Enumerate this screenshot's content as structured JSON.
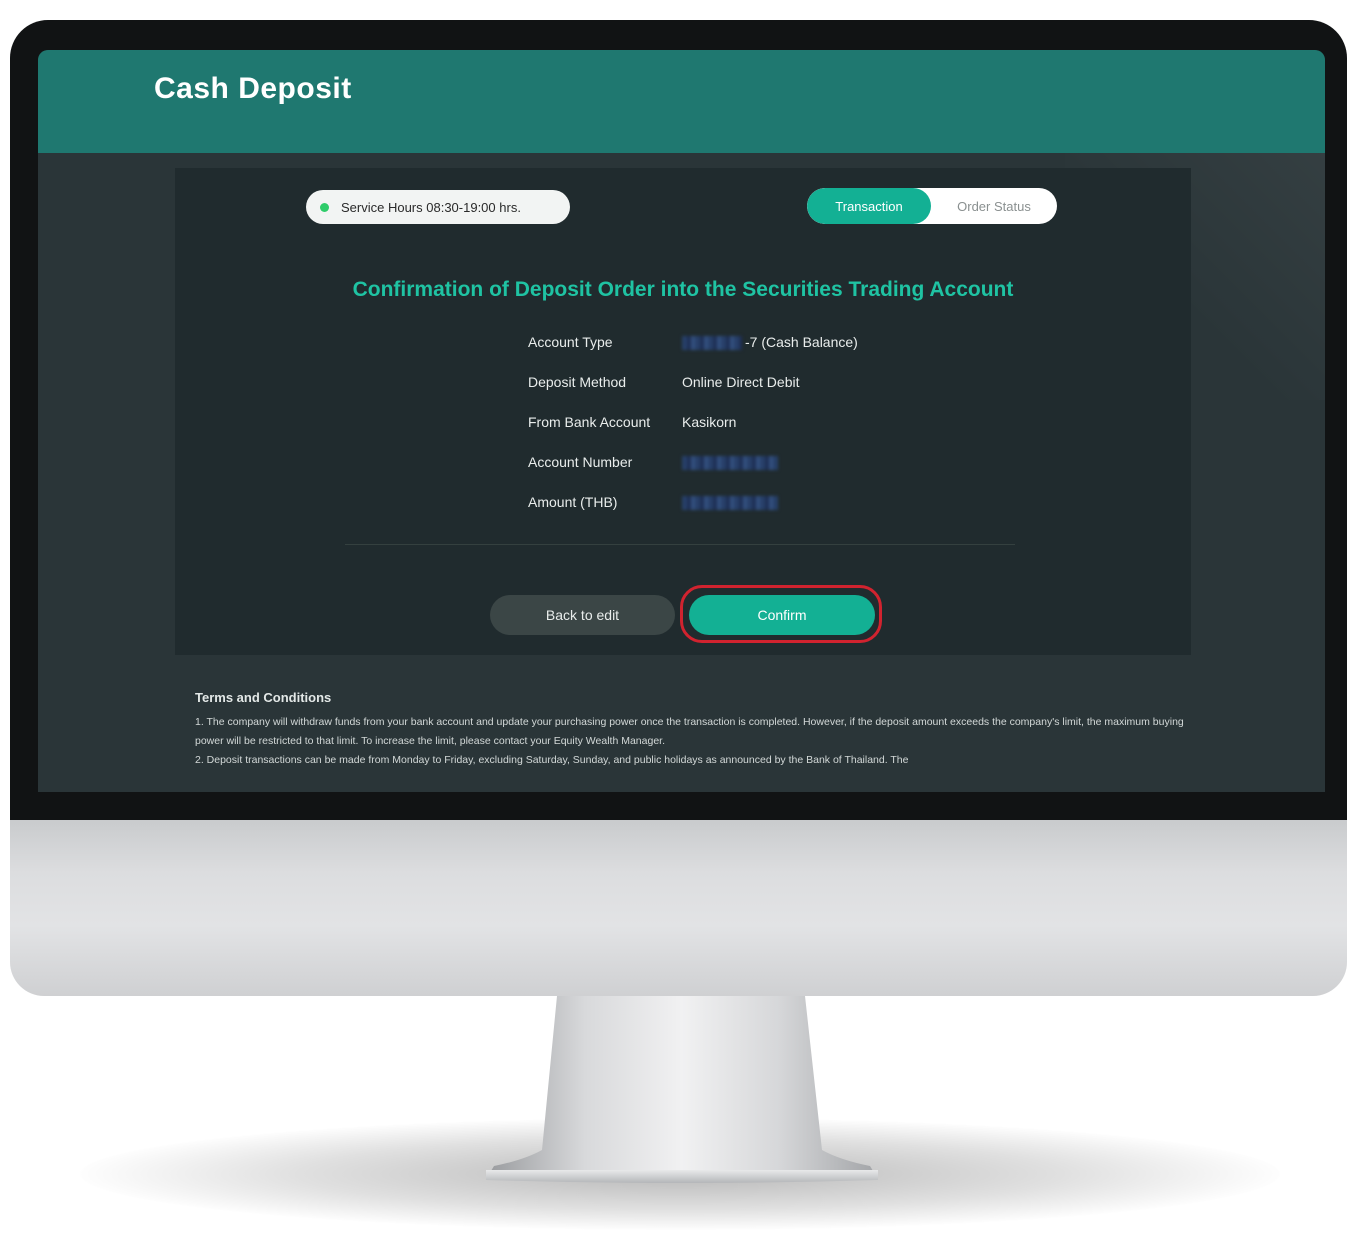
{
  "page": {
    "title": "Cash Deposit"
  },
  "service": {
    "hours_text": "Service Hours 08:30-19:00 hrs."
  },
  "tabs": [
    {
      "label": "Transaction",
      "active": true
    },
    {
      "label": "Order Status",
      "active": false
    }
  ],
  "confirmation": {
    "heading": "Confirmation of Deposit Order into the Securities Trading Account",
    "details": [
      {
        "label": "Account Type",
        "value": "-7 (Cash Balance)",
        "redacted_prefix": true
      },
      {
        "label": "Deposit Method",
        "value": "Online Direct Debit"
      },
      {
        "label": "From Bank Account",
        "value": "Kasikorn"
      },
      {
        "label": "Account Number",
        "value": "",
        "redacted": true
      },
      {
        "label": "Amount (THB)",
        "value": "",
        "redacted": true
      }
    ]
  },
  "actions": {
    "back_label": "Back to edit",
    "confirm_label": "Confirm"
  },
  "terms": {
    "title": "Terms and Conditions",
    "items": [
      "1. The company will withdraw funds from your bank account and update your purchasing power once the transaction is completed. However, if the deposit amount exceeds the company's limit, the maximum buying power will be restricted to that limit. To increase the limit, please contact your Equity Wealth Manager.",
      "2. Deposit transactions can be made from Monday to Friday, excluding Saturday, Sunday, and public holidays as announced by the Bank of Thailand. The"
    ]
  },
  "colors": {
    "header_bg": "#1f7870",
    "accent": "#13b094",
    "heading": "#1fc3a3",
    "highlight": "#d1232f",
    "screen_bg": "#2a3538"
  }
}
